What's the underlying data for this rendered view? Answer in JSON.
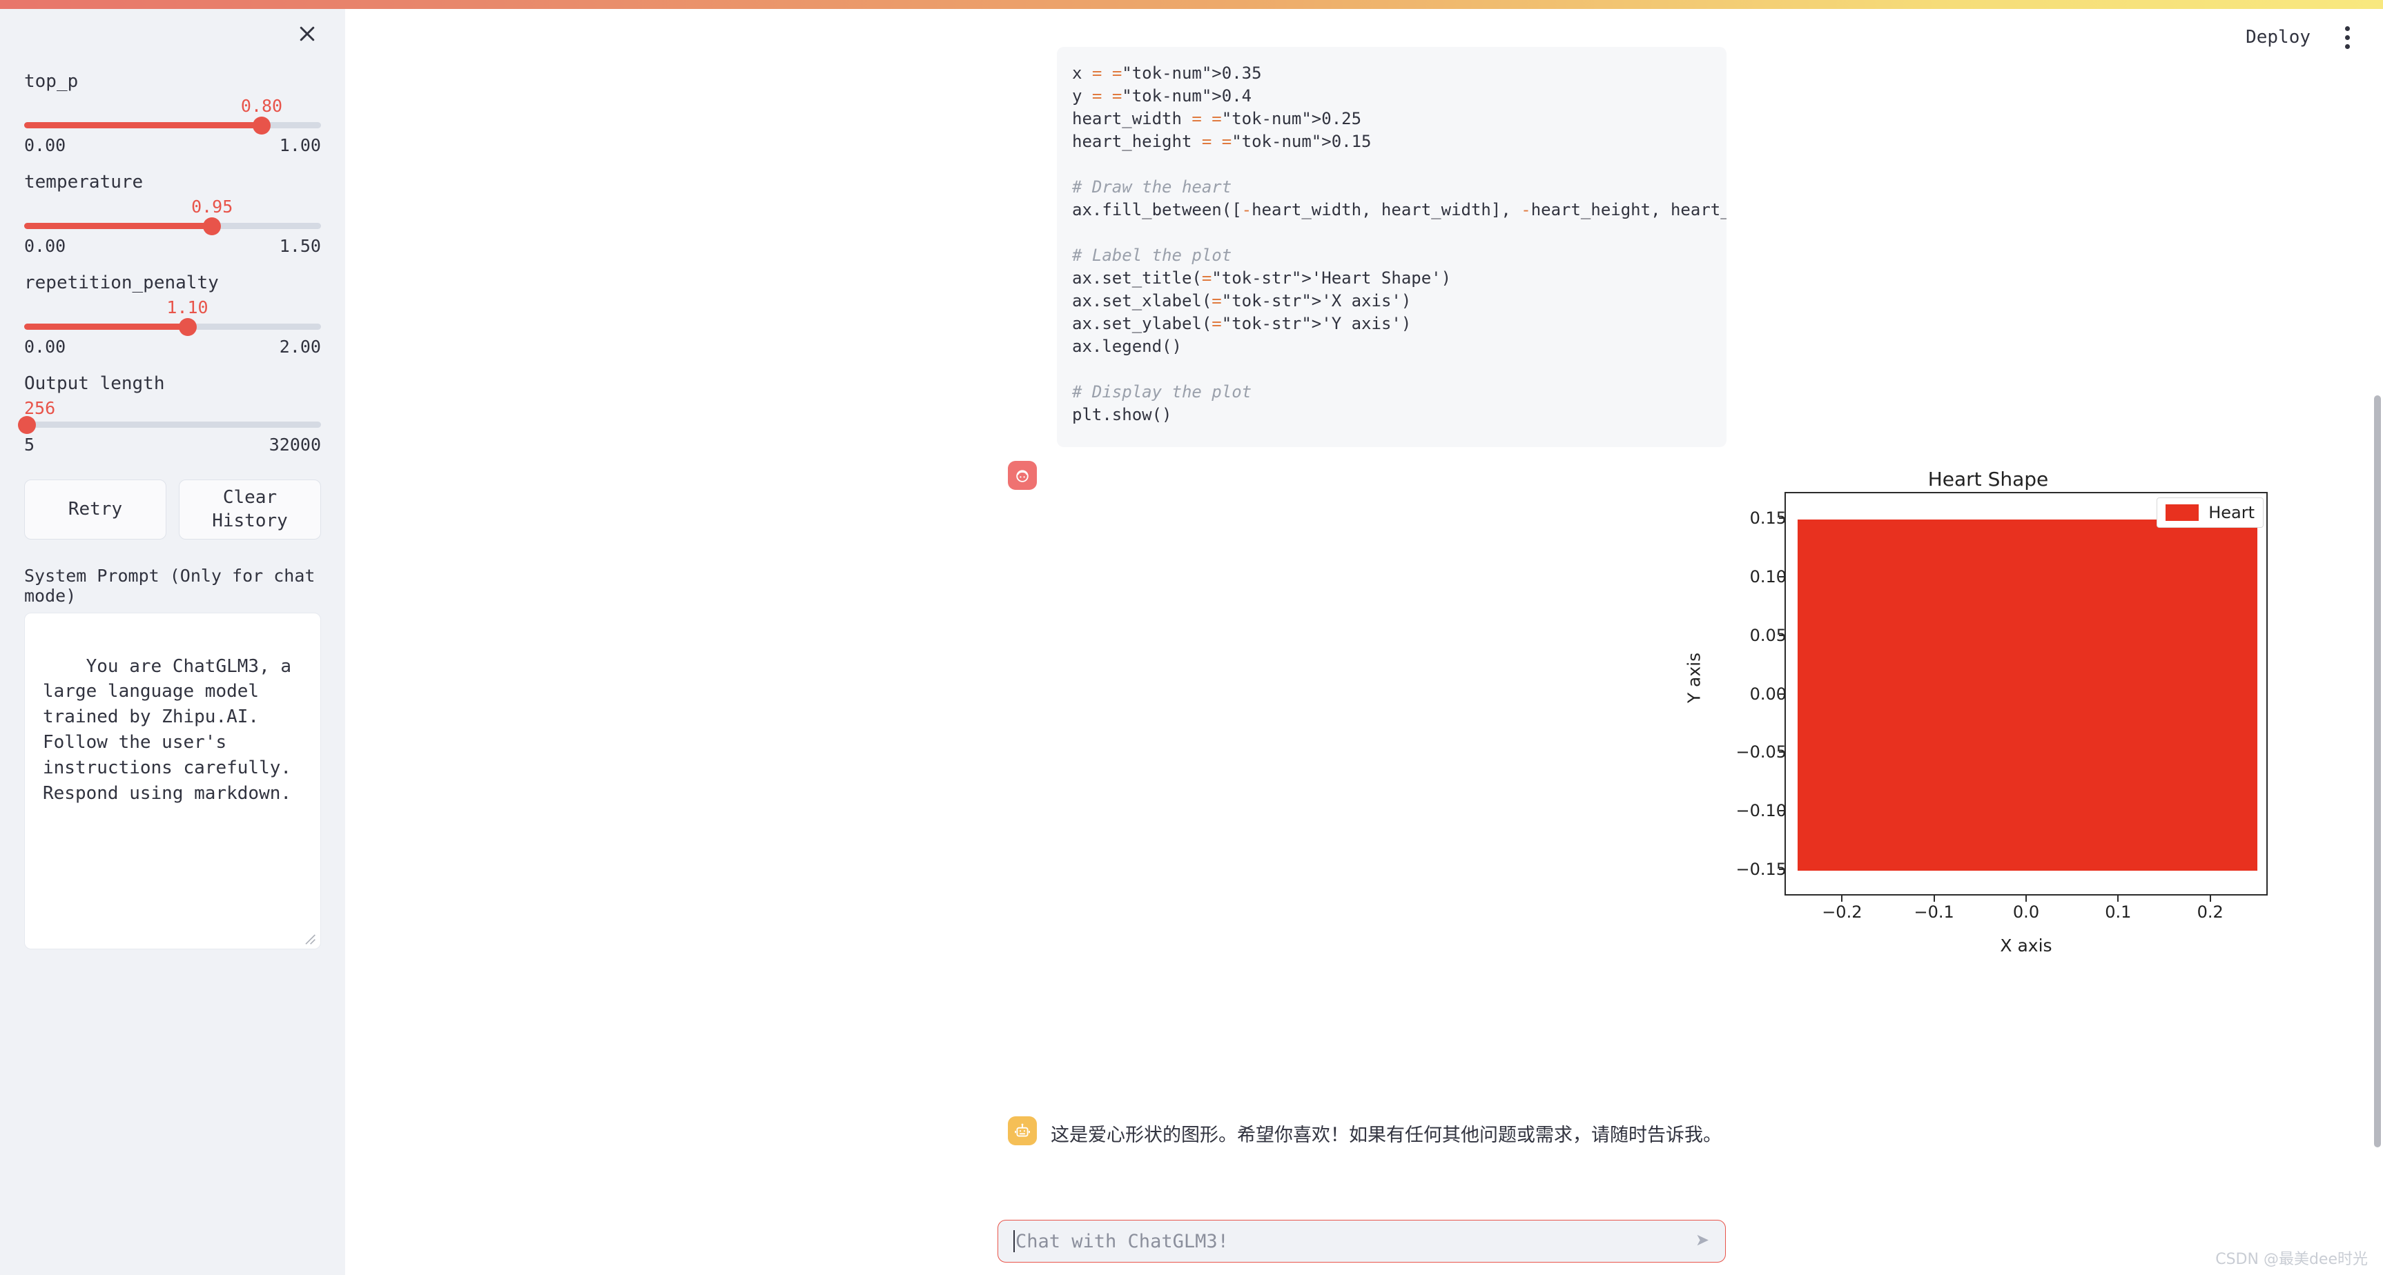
{
  "top_progress": {
    "name": "generation-progress-bar",
    "colors": [
      "#e8766b",
      "#edaa6a",
      "#f8e87f"
    ]
  },
  "sidebar": {
    "close_icon": "close-icon",
    "sliders": [
      {
        "label": "top_p",
        "value": "0.80",
        "min": "0.00",
        "max": "1.00",
        "pct": 80
      },
      {
        "label": "temperature",
        "value": "0.95",
        "min": "0.00",
        "max": "1.50",
        "pct": 63.3
      },
      {
        "label": "repetition_penalty",
        "value": "1.10",
        "min": "0.00",
        "max": "2.00",
        "pct": 55
      },
      {
        "label": "Output length",
        "value": "256",
        "min": "5",
        "max": "32000",
        "pct": 0.8
      }
    ],
    "buttons": {
      "retry": "Retry",
      "clear_history": "Clear History"
    },
    "system_prompt_label": "System Prompt (Only for chat mode)",
    "system_prompt_value": "You are ChatGLM3, a large language model trained by Zhipu.AI. Follow the user's instructions carefully. Respond using markdown."
  },
  "header": {
    "deploy_label": "Deploy",
    "menu_icon": "kebab-menu-icon"
  },
  "code_block": {
    "language": "python",
    "lines": [
      "x = 0.35",
      "y = 0.4",
      "heart_width = 0.25",
      "heart_height = 0.15",
      "",
      "# Draw the heart",
      "ax.fill_between([-heart_width, heart_width], -heart_height, heart_height, co",
      "",
      "# Label the plot",
      "ax.set_title('Heart Shape')",
      "ax.set_xlabel('X axis')",
      "ax.set_ylabel('Y axis')",
      "ax.legend()",
      "",
      "# Display the plot",
      "plt.show()"
    ]
  },
  "chart_data": {
    "type": "area",
    "title": "Heart Shape",
    "xlabel": "X axis",
    "ylabel": "Y axis",
    "legend": [
      {
        "name": "Heart",
        "color": "#e8311f"
      }
    ],
    "legend_position": "upper right",
    "grid": false,
    "xlim": [
      -0.2625,
      0.2625
    ],
    "ylim": [
      -0.1725,
      0.1725
    ],
    "xticks": [
      -0.2,
      -0.1,
      0.0,
      0.1,
      0.2
    ],
    "xticklabels": [
      "−0.2",
      "−0.1",
      "0.0",
      "0.1",
      "0.2"
    ],
    "yticks": [
      -0.15,
      -0.1,
      -0.05,
      0.0,
      0.05,
      0.1,
      0.15
    ],
    "yticklabels": [
      "−0.15",
      "−0.10",
      "−0.05",
      "0.00",
      "0.05",
      "0.10",
      "0.15"
    ],
    "series": [
      {
        "name": "Heart",
        "x": [
          -0.25,
          0.25
        ],
        "y_lower": [
          -0.15,
          -0.15
        ],
        "y_upper": [
          0.15,
          0.15
        ],
        "color": "#e8311f"
      }
    ]
  },
  "messages": [
    {
      "role": "user",
      "avatar": "user-avatar-icon",
      "kind": "plot"
    },
    {
      "role": "assistant",
      "avatar": "bot-avatar-icon",
      "kind": "text",
      "text": "这是爱心形状的图形。希望你喜欢！如果有任何其他问题或需求，请随时告诉我。"
    }
  ],
  "chat_input": {
    "placeholder": "Chat with ChatGLM3!",
    "value": "",
    "send_icon": "send-arrow-icon"
  },
  "watermark": "CSDN @最美dee时光"
}
